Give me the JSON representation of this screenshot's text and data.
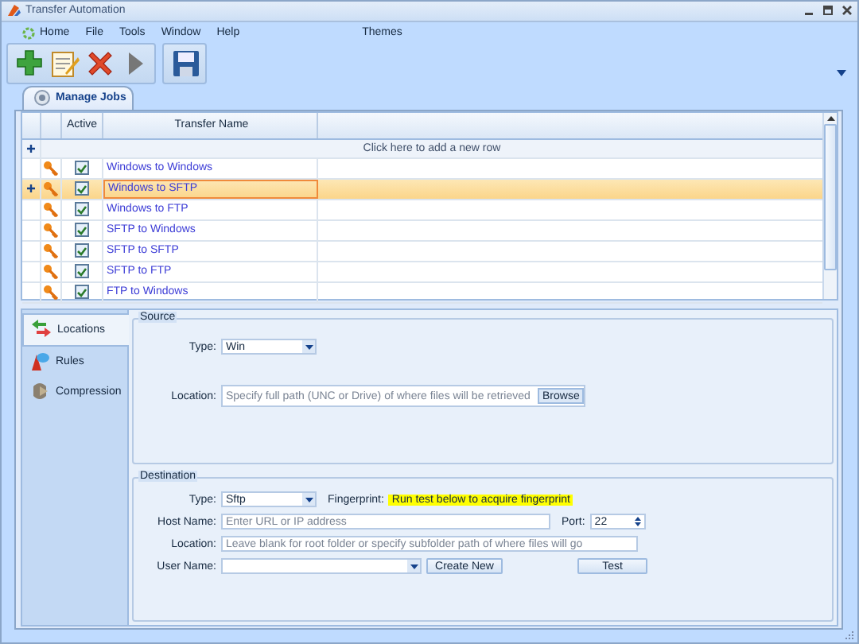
{
  "window": {
    "title": "Transfer Automation"
  },
  "menu": [
    {
      "label": "Home",
      "kind": "home"
    },
    {
      "label": "File",
      "kind": "plain"
    },
    {
      "label": "Tools",
      "kind": "plain"
    },
    {
      "label": "Window",
      "kind": "plain"
    },
    {
      "label": "Help",
      "kind": "plain"
    },
    {
      "label": "Themes",
      "kind": "themes"
    }
  ],
  "toolbar": [
    {
      "kind": "add"
    },
    {
      "kind": "edit"
    },
    {
      "kind": "delete"
    },
    {
      "kind": "run"
    },
    {
      "kind": "separator"
    },
    {
      "kind": "save"
    }
  ],
  "tabs": [
    {
      "label": "Manage Jobs",
      "selected": true
    }
  ],
  "grid": {
    "columns": [
      "Active",
      "Transfer Name"
    ],
    "new_row_hint": "Click here to add a new row",
    "rows": [
      {
        "name": "Windows to Windows",
        "active": true,
        "selected": false
      },
      {
        "name": "Windows to SFTP",
        "active": true,
        "selected": true
      },
      {
        "name": "Windows to FTP",
        "active": true,
        "selected": false
      },
      {
        "name": "SFTP to Windows",
        "active": true,
        "selected": false
      },
      {
        "name": "SFTP to SFTP",
        "active": true,
        "selected": false
      },
      {
        "name": "SFTP to FTP",
        "active": true,
        "selected": false
      },
      {
        "name": "FTP to Windows",
        "active": true,
        "selected": false
      }
    ]
  },
  "side_tabs": [
    {
      "label": "Locations",
      "kind": "locations",
      "selected": true
    },
    {
      "label": "Rules",
      "kind": "rules",
      "selected": false
    },
    {
      "label": "Compression",
      "kind": "compression",
      "selected": false
    }
  ],
  "source": {
    "title": "Source",
    "type_label": "Type:",
    "type_value": "Win",
    "location_label": "Location:",
    "location_placeholder": "Specify full path (UNC or Drive) of where files will be retrieved",
    "browse": "Browse"
  },
  "destination": {
    "title": "Destination",
    "type_label": "Type:",
    "type_value": "Sftp",
    "fingerprint_label": "Fingerprint:",
    "fingerprint_value": "Run test below to acquire fingerprint",
    "host_label": "Host Name:",
    "host_placeholder": "Enter URL or IP address",
    "port_label": "Port:",
    "port_value": "22",
    "location_label": "Location:",
    "location_placeholder": "Leave blank for root folder or specify subfolder path of where files will go",
    "user_label": "User Name:",
    "create_new": "Create New",
    "test": "Test"
  }
}
